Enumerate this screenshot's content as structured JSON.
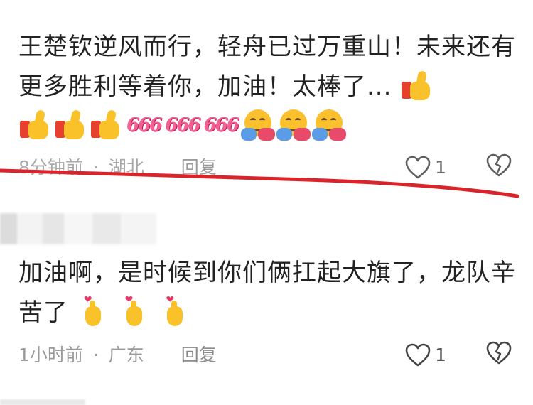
{
  "comments": [
    {
      "text": "王楚钦逆风而行，轻舟已过万重山！未来还有更多胜利等着你，加油！太棒了...",
      "emoji_row": [
        "thumbs-up",
        "thumbs-up",
        "thumbs-up",
        "666",
        "666",
        "666",
        "hugging-face",
        "hugging-face",
        "hugging-face"
      ],
      "six_label": "666",
      "time": "8分钟前",
      "separator": "·",
      "location": "湖北",
      "reply": "回复",
      "likes": "1"
    },
    {
      "text": "加油啊，是时候到你们俩扛起大旗了，龙队辛苦了",
      "emoji_row": [
        "finger-heart",
        "finger-heart",
        "finger-heart"
      ],
      "time": "1小时前",
      "separator": "·",
      "location": "广东",
      "reply": "回复",
      "likes": "1"
    }
  ],
  "colors": {
    "text": "#222222",
    "meta": "#9a9a9a",
    "annotation_line": "#d9242b",
    "emoji_yellow": "#f9c22b",
    "six_pink": "#f06292"
  }
}
